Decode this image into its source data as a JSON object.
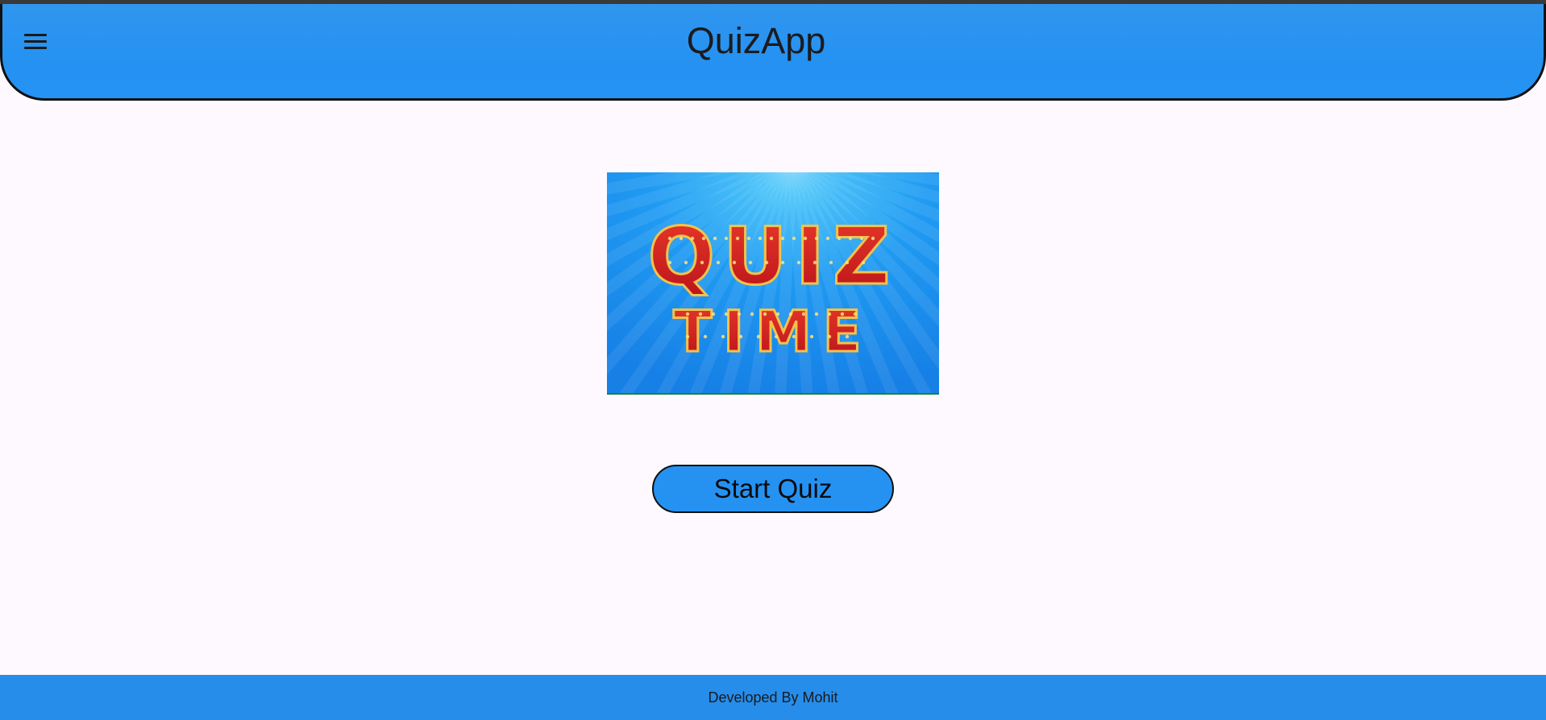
{
  "app_bar": {
    "title": "QuizApp",
    "menu_icon": "hamburger-menu-icon"
  },
  "banner": {
    "line1": "QUIZ",
    "line2": "TIME"
  },
  "actions": {
    "start_label": "Start Quiz"
  },
  "footer": {
    "text": "Developed By Mohit"
  },
  "colors": {
    "primary": "#2592f2",
    "background": "#fdf9fe",
    "footer": "#268deb",
    "banner_bg": "#1f8ff0",
    "marquee_letter": "#d42020",
    "marquee_bulb": "#ffe27a"
  }
}
